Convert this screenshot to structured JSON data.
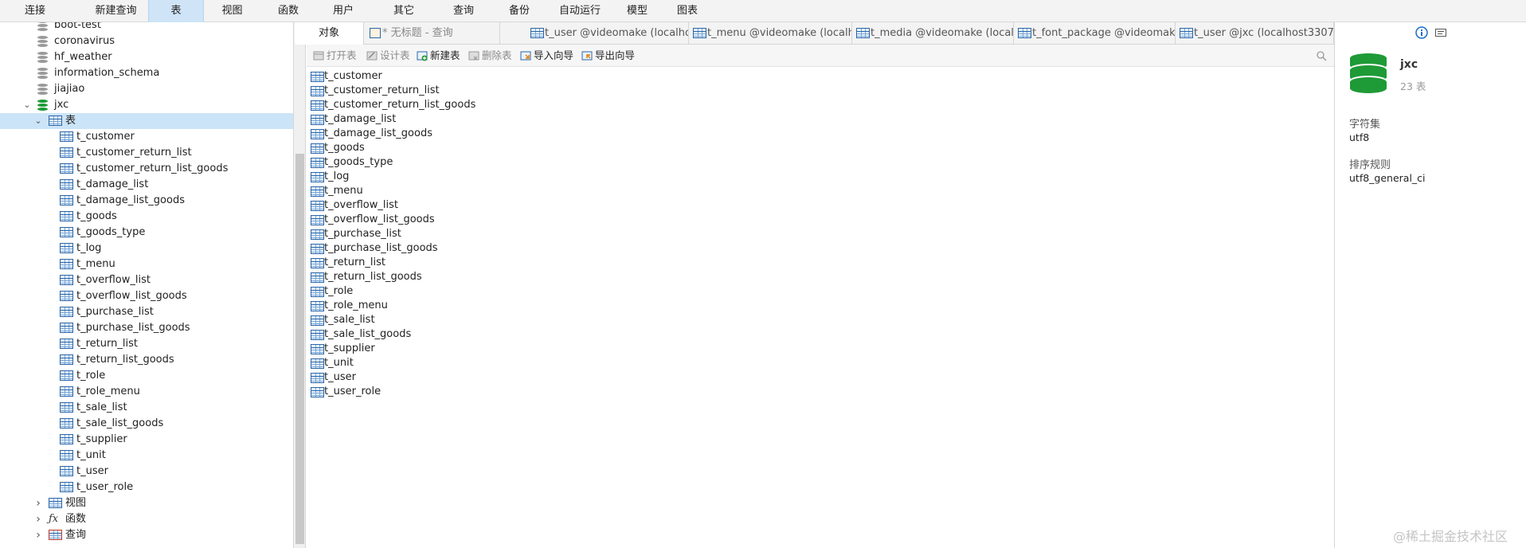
{
  "menubar": {
    "items": [
      "连接",
      "新建查询",
      "表",
      "视图",
      "函数",
      "用户",
      "其它",
      "查询",
      "备份",
      "自动运行",
      "模型",
      "图表"
    ],
    "active_index": 2
  },
  "tree": {
    "top_dbs": [
      "boot-test",
      "coronavirus",
      "hf_weather",
      "information_schema",
      "jiajiao"
    ],
    "current_db": "jxc",
    "tables_node": "表",
    "tables": [
      "t_customer",
      "t_customer_return_list",
      "t_customer_return_list_goods",
      "t_damage_list",
      "t_damage_list_goods",
      "t_goods",
      "t_goods_type",
      "t_log",
      "t_menu",
      "t_overflow_list",
      "t_overflow_list_goods",
      "t_purchase_list",
      "t_purchase_list_goods",
      "t_return_list",
      "t_return_list_goods",
      "t_role",
      "t_role_menu",
      "t_sale_list",
      "t_sale_list_goods",
      "t_supplier",
      "t_unit",
      "t_user",
      "t_user_role"
    ],
    "other_nodes": [
      "视图",
      "函数",
      "查询"
    ]
  },
  "tabs": {
    "objects": "对象",
    "items": [
      "* 无标题 - 查询",
      "t_user @videomake (localho...",
      "t_menu @videomake (localh...",
      "t_media @videomake (local...",
      "t_font_package @videomak...",
      "t_user @jxc (localhost3307) ..."
    ]
  },
  "toolbar": {
    "open": "打开表",
    "design": "设计表",
    "new": "新建表",
    "delete": "删除表",
    "import": "导入向导",
    "export": "导出向导"
  },
  "object_list": [
    "t_customer",
    "t_customer_return_list",
    "t_customer_return_list_goods",
    "t_damage_list",
    "t_damage_list_goods",
    "t_goods",
    "t_goods_type",
    "t_log",
    "t_menu",
    "t_overflow_list",
    "t_overflow_list_goods",
    "t_purchase_list",
    "t_purchase_list_goods",
    "t_return_list",
    "t_return_list_goods",
    "t_role",
    "t_role_menu",
    "t_sale_list",
    "t_sale_list_goods",
    "t_supplier",
    "t_unit",
    "t_user",
    "t_user_role"
  ],
  "info_panel": {
    "db_name": "jxc",
    "table_count": "23 表",
    "charset_label": "字符集",
    "charset_value": "utf8",
    "collation_label": "排序规则",
    "collation_value": "utf8_general_ci"
  },
  "watermark": "@稀土掘金技术社区",
  "colors": {
    "accent": "#cce4f7",
    "db_green": "#1e9a36",
    "table_blue": "#2a66a8"
  }
}
